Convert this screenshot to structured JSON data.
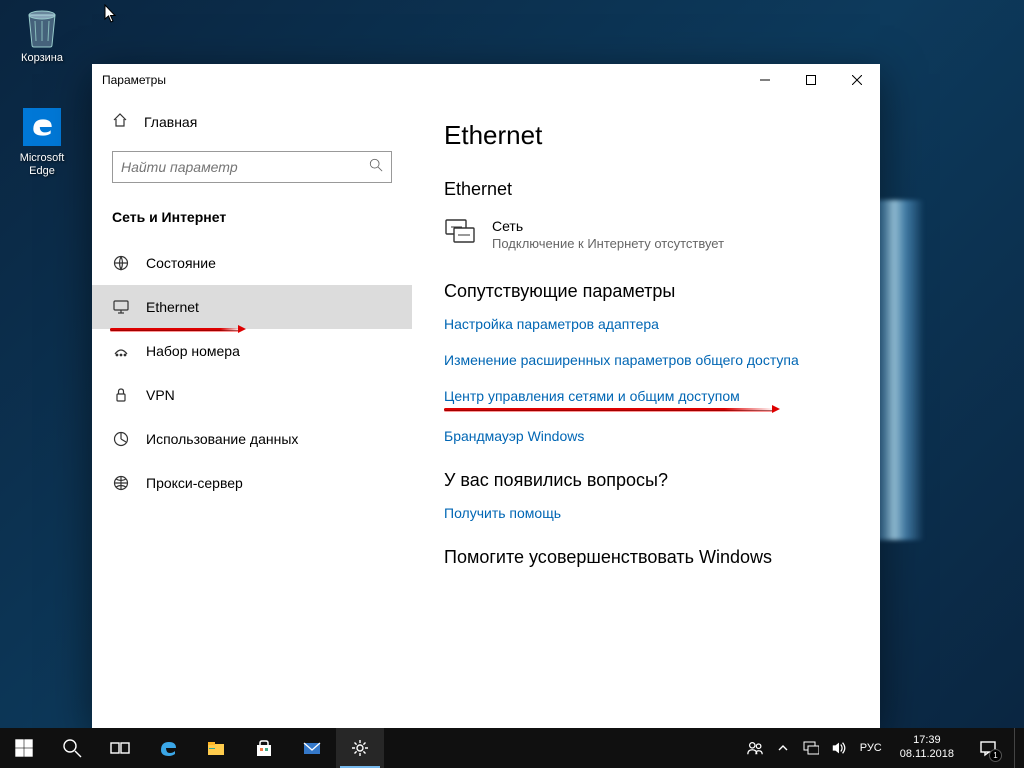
{
  "desktop": {
    "icons": {
      "recycle_bin": "Корзина",
      "edge": "Microsoft Edge"
    }
  },
  "window": {
    "title": "Параметры",
    "sidebar": {
      "home": "Главная",
      "search_placeholder": "Найти параметр",
      "category": "Сеть и Интернет",
      "items": [
        {
          "label": "Состояние"
        },
        {
          "label": "Ethernet"
        },
        {
          "label": "Набор номера"
        },
        {
          "label": "VPN"
        },
        {
          "label": "Использование данных"
        },
        {
          "label": "Прокси-сервер"
        }
      ]
    },
    "content": {
      "page_title": "Ethernet",
      "section_ethernet": "Ethernet",
      "network": {
        "name": "Сеть",
        "desc": "Подключение к Интернету отсутствует"
      },
      "section_related": "Сопутствующие параметры",
      "links": [
        "Настройка параметров адаптера",
        "Изменение расширенных параметров общего доступа",
        "Центр управления сетями и общим доступом",
        "Брандмауэр Windows"
      ],
      "section_questions": "У вас появились вопросы?",
      "help_link": "Получить помощь",
      "section_feedback": "Помогите усовершенствовать Windows"
    }
  },
  "taskbar": {
    "lang": "РУС",
    "time": "17:39",
    "date": "08.11.2018",
    "notif_count": "1"
  }
}
